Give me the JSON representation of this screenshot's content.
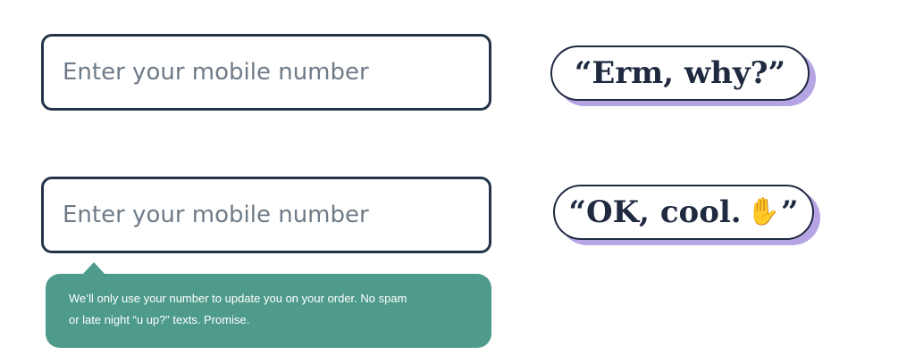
{
  "form": {
    "mobile_input_empty": {
      "placeholder": "Enter your mobile number",
      "value": ""
    },
    "mobile_input_with_hint": {
      "placeholder": "Enter your mobile number",
      "value": ""
    },
    "hint": {
      "line1": "We’ll only use your number to update you on your order. No spam",
      "line2": "or late night “u up?” texts. Promise."
    }
  },
  "reactions": {
    "without_hint": "“Erm, why?”",
    "with_hint": {
      "text": "“OK, cool.",
      "emoji": "call-me-hand",
      "close_quote": "”"
    }
  },
  "colors": {
    "border_dark": "#243447",
    "placeholder": "#6e7b88",
    "tooltip_bg": "#4f9b8b",
    "bubble_shadow": "#b5a5e4"
  }
}
